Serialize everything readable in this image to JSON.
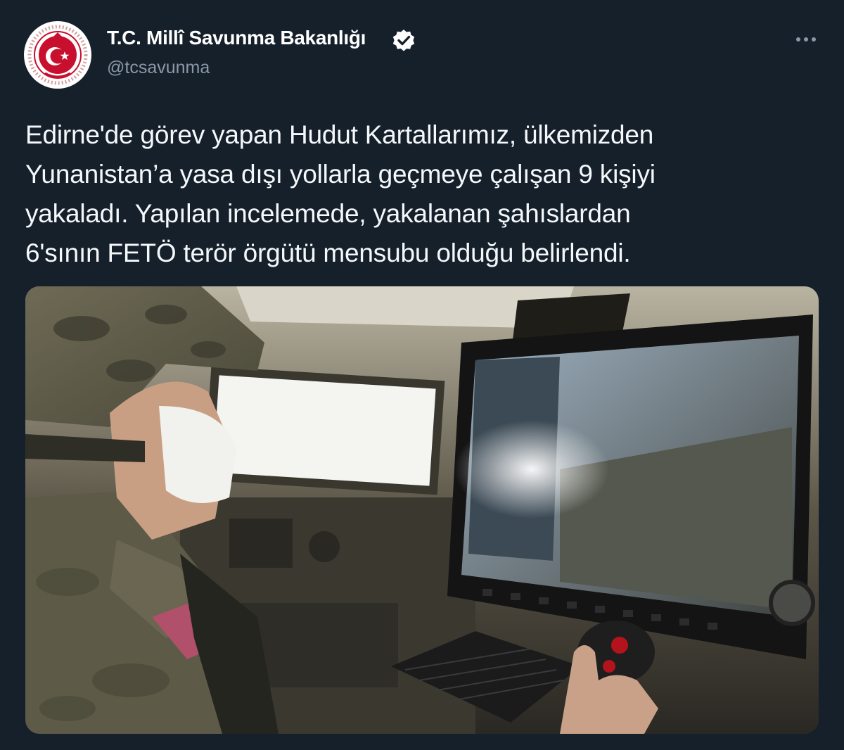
{
  "tweet": {
    "author": {
      "display_name": "T.C. Millî Savunma Bakanlığı",
      "handle": "@tcsavunma",
      "verified": true,
      "avatar_icon": "ministry-emblem-icon"
    },
    "text_lines": [
      "Edirne'de görev yapan Hudut Kartallarımız, ülkemizden",
      "Yunanistan’a yasa dışı yollarla geçmeye çalışan 9 kişiyi",
      "yakaladı. Yapılan incelemede, yakalanan şahıslardan",
      "6'sının FETÖ terör örgütü mensubu olduğu belirlendi."
    ],
    "more_icon": "more-horizontal-icon"
  },
  "colors": {
    "background": "#15202b",
    "text": "#f5f8fa",
    "secondary_text": "#8b98a5",
    "verified_badge": "#ffffff",
    "emblem_red": "#c8102e"
  }
}
